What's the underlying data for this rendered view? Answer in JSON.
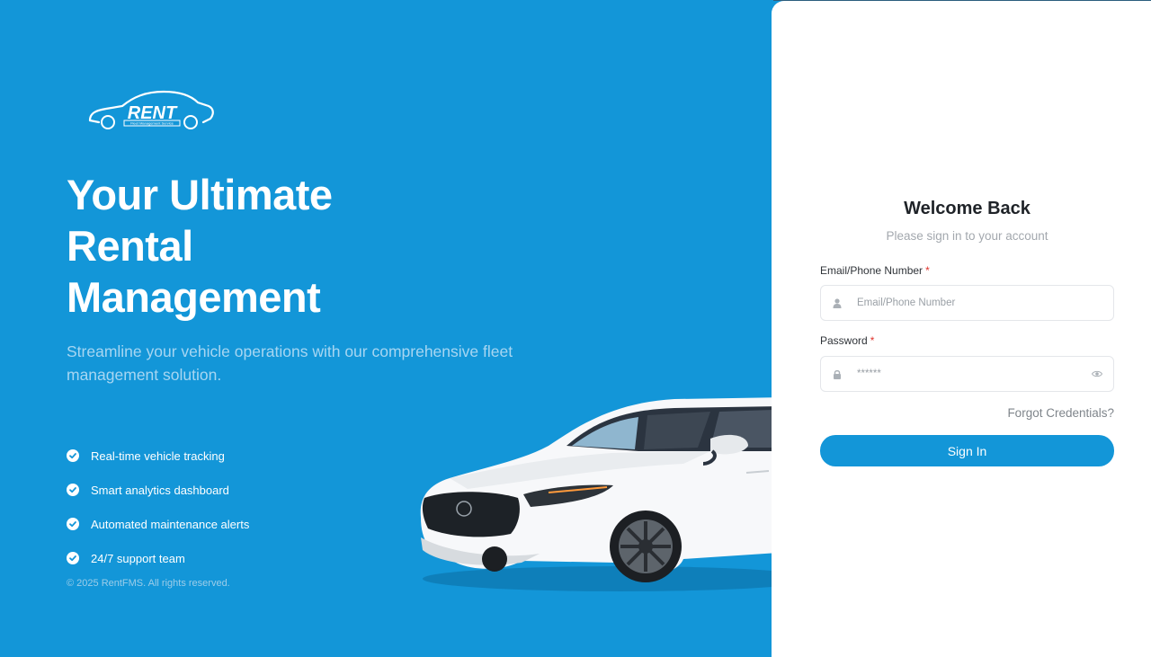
{
  "brand": {
    "logo_text": "RENT",
    "logo_tagline": "Fleet Management Service",
    "hero_title_lines": [
      "Your Ultimate",
      "Rental",
      "Management"
    ],
    "hero_subtitle": "Streamline your vehicle operations with our comprehensive fleet management solution.",
    "features": [
      "Real-time vehicle tracking",
      "Smart analytics dashboard",
      "Automated maintenance alerts",
      "24/7 support team"
    ],
    "copyright": "© 2025 RentFMS. All rights reserved."
  },
  "login": {
    "title": "Welcome Back",
    "subtitle": "Please sign in to your account",
    "email_label": "Email/Phone Number",
    "email_placeholder": "Email/Phone Number",
    "email_value": "",
    "password_label": "Password",
    "password_placeholder": "******",
    "password_value": "",
    "required_marker": "*",
    "forgot_label": "Forgot Credentials?",
    "signin_label": "Sign In"
  },
  "icons": {
    "email_field_icon": "user-icon",
    "password_field_icon": "lock-icon",
    "password_toggle_icon": "eye-icon",
    "feature_icon": "check-circle-icon"
  },
  "colors": {
    "brand_blue": "#1396d8",
    "required_red": "#e0322b",
    "panel_white": "#ffffff"
  }
}
